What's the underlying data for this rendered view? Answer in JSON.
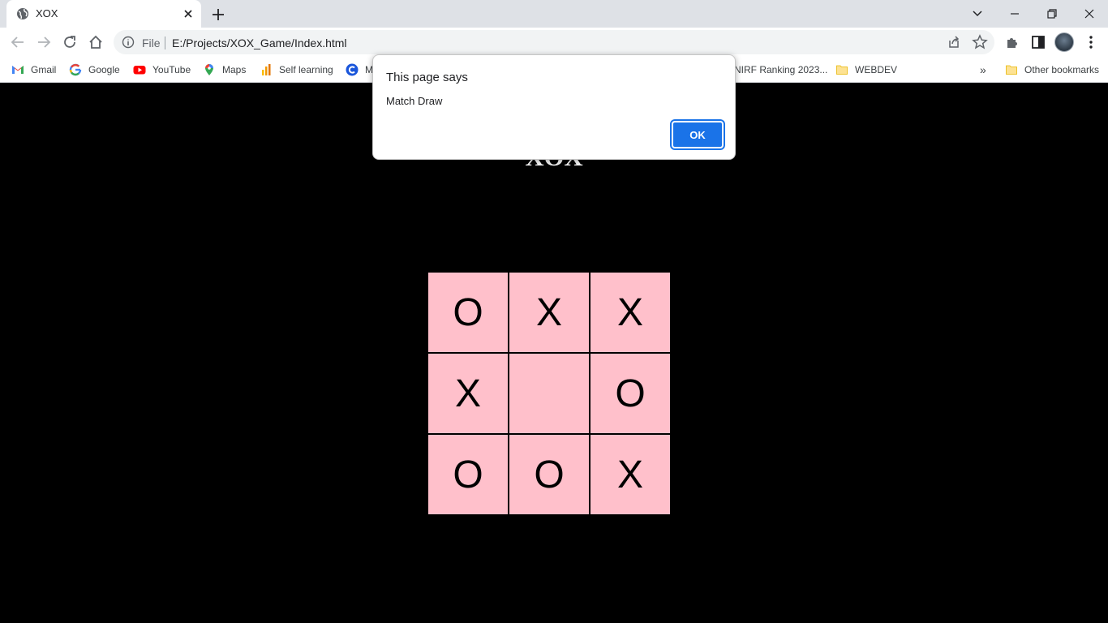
{
  "browser": {
    "tab": {
      "title": "XOX"
    },
    "address": {
      "scheme_label": "File",
      "url": "E:/Projects/XOX_Game/Index.html"
    },
    "bookmarks": [
      {
        "label": "Gmail",
        "icon": "gmail-icon"
      },
      {
        "label": "Google",
        "icon": "google-icon"
      },
      {
        "label": "YouTube",
        "icon": "youtube-icon"
      },
      {
        "label": "Maps",
        "icon": "maps-icon"
      },
      {
        "label": "Self learning",
        "icon": "analytics-icon"
      },
      {
        "label": "M",
        "icon": "c-icon"
      },
      {
        "label": "NIRF Ranking 2023...",
        "icon": "page-icon"
      },
      {
        "label": "WEBDEV",
        "icon": "folder-icon"
      }
    ],
    "overflow_label": "»",
    "other_bookmarks": "Other bookmarks"
  },
  "page": {
    "heading": "XOX",
    "board": [
      [
        "O",
        "X",
        "X"
      ],
      [
        "X",
        "",
        "O"
      ],
      [
        "O",
        "O",
        "X"
      ]
    ]
  },
  "dialog": {
    "title": "This page says",
    "message": "Match Draw",
    "ok_label": "OK"
  },
  "colors": {
    "page_background": "#000000",
    "cell_background": "#ffc0cb",
    "accent": "#1a73e8"
  }
}
